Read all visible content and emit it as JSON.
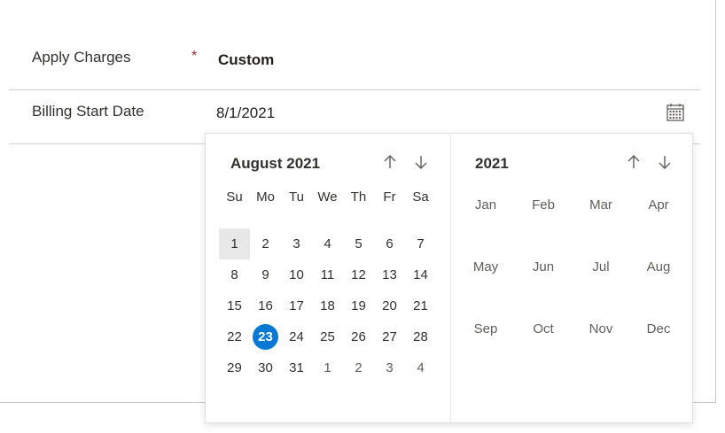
{
  "form": {
    "apply_charges_label": "Apply Charges",
    "required_marker": "*",
    "apply_charges_value": "Custom",
    "billing_start_label": "Billing Start Date",
    "billing_start_value": "8/1/2021",
    "calendar_icon": "calendar-icon"
  },
  "calendar": {
    "month_title": "August 2021",
    "prev_icon": "arrow-up-icon",
    "next_icon": "arrow-down-icon",
    "weekdays": [
      "Su",
      "Mo",
      "Tu",
      "We",
      "Th",
      "Fr",
      "Sa"
    ],
    "weeks": [
      [
        "",
        "",
        "",
        "",
        "",
        "",
        ""
      ],
      [
        "1",
        "2",
        "3",
        "4",
        "5",
        "6",
        "7"
      ],
      [
        "8",
        "9",
        "10",
        "11",
        "12",
        "13",
        "14"
      ],
      [
        "15",
        "16",
        "17",
        "18",
        "19",
        "20",
        "21"
      ],
      [
        "22",
        "23",
        "24",
        "25",
        "26",
        "27",
        "28"
      ],
      [
        "29",
        "30",
        "31",
        "1",
        "2",
        "3",
        "4"
      ]
    ],
    "selected_day": "1",
    "today": "23",
    "accent": "#0078d4",
    "selected_bg": "#e8e8e8"
  },
  "year_picker": {
    "year_title": "2021",
    "months": [
      "Jan",
      "Feb",
      "Mar",
      "Apr",
      "May",
      "Jun",
      "Jul",
      "Aug",
      "Sep",
      "Oct",
      "Nov",
      "Dec"
    ]
  }
}
